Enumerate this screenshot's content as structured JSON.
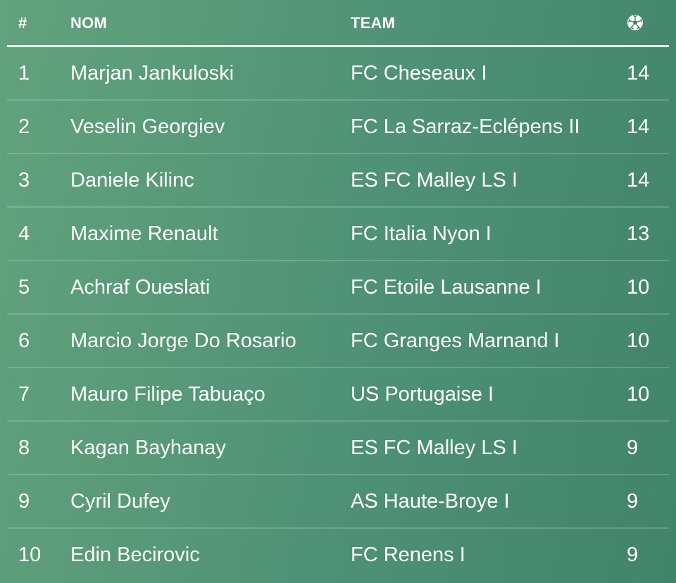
{
  "table": {
    "headers": {
      "rank": "#",
      "name": "NOM",
      "team": "TEAM",
      "goals_icon": "soccer-ball-icon"
    },
    "rows": [
      {
        "rank": "1",
        "name": "Marjan Jankuloski",
        "team": "FC Cheseaux I",
        "goals": "14"
      },
      {
        "rank": "2",
        "name": "Veselin Georgiev",
        "team": "FC La Sarraz-Eclépens II",
        "goals": "14"
      },
      {
        "rank": "3",
        "name": "Daniele Kilinc",
        "team": "ES FC Malley LS I",
        "goals": "14"
      },
      {
        "rank": "4",
        "name": "Maxime Renault",
        "team": "FC Italia Nyon I",
        "goals": "13"
      },
      {
        "rank": "5",
        "name": "Achraf Oueslati",
        "team": "FC Etoile Lausanne I",
        "goals": "10"
      },
      {
        "rank": "6",
        "name": "Marcio Jorge Do Rosario",
        "team": "FC Granges Marnand I",
        "goals": "10"
      },
      {
        "rank": "7",
        "name": "Mauro Filipe Tabuaço",
        "team": "US Portugaise I",
        "goals": "10"
      },
      {
        "rank": "8",
        "name": "Kagan Bayhanay",
        "team": "ES FC Malley LS I",
        "goals": "9"
      },
      {
        "rank": "9",
        "name": "Cyril Dufey",
        "team": "AS Haute-Broye I",
        "goals": "9"
      },
      {
        "rank": "10",
        "name": "Edin Becirovic",
        "team": "FC Renens I",
        "goals": "9"
      }
    ]
  },
  "colors": {
    "background_start": "#62a27c",
    "background_end": "#428468",
    "text": "#ffffff"
  }
}
